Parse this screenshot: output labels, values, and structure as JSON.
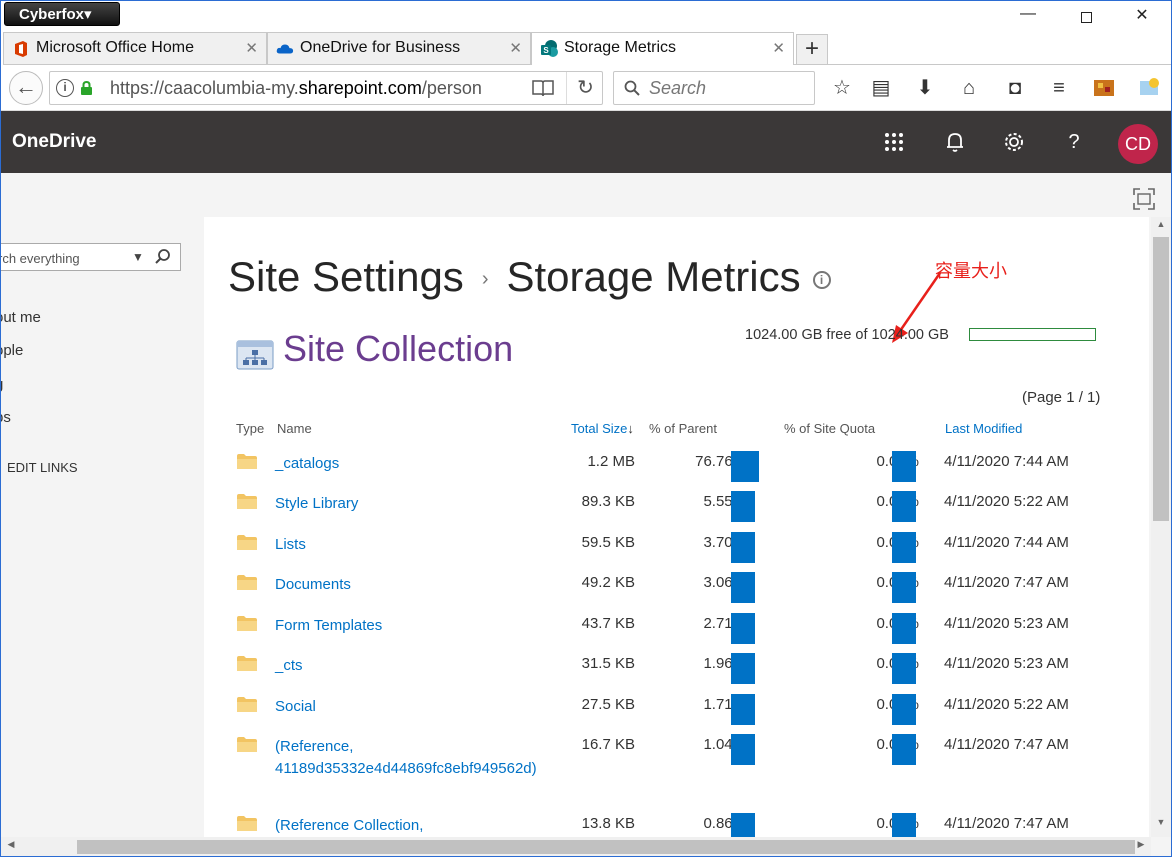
{
  "browser": {
    "menu_label": "Cyberfox▾",
    "tabs": [
      {
        "title": "Microsoft Office Home",
        "icon": "office-icon"
      },
      {
        "title": "OneDrive for Business",
        "icon": "onedrive-cloud-icon"
      },
      {
        "title": "Storage Metrics",
        "icon": "sharepoint-icon"
      }
    ],
    "tab_close": "✕",
    "new_tab": "+",
    "url_prefix": "https://caacolumbia-my.",
    "url_domain": "sharepoint.com",
    "url_suffix": "/person",
    "search_placeholder": "Search"
  },
  "suite": {
    "brand": "OneDrive",
    "avatar_initials": "CD",
    "avatar_color": "#c0254b"
  },
  "leftnav": {
    "search_placeholder": "rch everything",
    "links": [
      "out me",
      "ople",
      "g",
      "ps"
    ],
    "edit_links": "EDIT LINKS"
  },
  "page": {
    "title_part1": "Site Settings",
    "title_sep": "›",
    "title_part2": "Storage Metrics",
    "annotation": "容量大小",
    "quota_text": "1024.00 GB free of 1024.00 GB",
    "quota_used_fraction": 0.0,
    "section_title": "Site Collection",
    "page_info": "(Page 1 / 1)"
  },
  "table": {
    "headers": {
      "type": "Type",
      "name": "Name",
      "total_size": "Total Size",
      "sort_indicator": "↓",
      "pct_parent": "% of Parent",
      "pct_quota": "% of Site Quota",
      "last_modified": "Last Modified"
    },
    "rows": [
      {
        "name": "_catalogs",
        "size": "1.2 MB",
        "pct_parent": "76.76%",
        "pct_quota": "0.00%",
        "modified": "4/11/2020 7:44 AM"
      },
      {
        "name": "Style Library",
        "size": "89.3 KB",
        "pct_parent": "5.55%",
        "pct_quota": "0.00%",
        "modified": "4/11/2020 5:22 AM"
      },
      {
        "name": "Lists",
        "size": "59.5 KB",
        "pct_parent": "3.70%",
        "pct_quota": "0.00%",
        "modified": "4/11/2020 7:44 AM"
      },
      {
        "name": "Documents",
        "size": "49.2 KB",
        "pct_parent": "3.06%",
        "pct_quota": "0.00%",
        "modified": "4/11/2020 7:47 AM"
      },
      {
        "name": "Form Templates",
        "size": "43.7 KB",
        "pct_parent": "2.71%",
        "pct_quota": "0.00%",
        "modified": "4/11/2020 5:23 AM"
      },
      {
        "name": "_cts",
        "size": "31.5 KB",
        "pct_parent": "1.96%",
        "pct_quota": "0.00%",
        "modified": "4/11/2020 5:23 AM"
      },
      {
        "name": "Social",
        "size": "27.5 KB",
        "pct_parent": "1.71%",
        "pct_quota": "0.00%",
        "modified": "4/11/2020 5:22 AM"
      },
      {
        "name": "(Reference,",
        "name_line2": "41189d35332e4d44869fc8ebf949562d)",
        "size": "16.7 KB",
        "pct_parent": "1.04%",
        "pct_quota": "0.00%",
        "modified": "4/11/2020 7:47 AM"
      },
      {
        "name": "(Reference Collection,",
        "size": "13.8 KB",
        "pct_parent": "0.86%",
        "pct_quota": "0.00%",
        "modified": "4/11/2020 7:47 AM"
      }
    ]
  },
  "colors": {
    "accent_blue": "#0072c6",
    "suite_bar": "#3b3838",
    "section_title": "#6b3d8f",
    "annotation_red": "#e8201b",
    "folder": "#f2c462"
  }
}
